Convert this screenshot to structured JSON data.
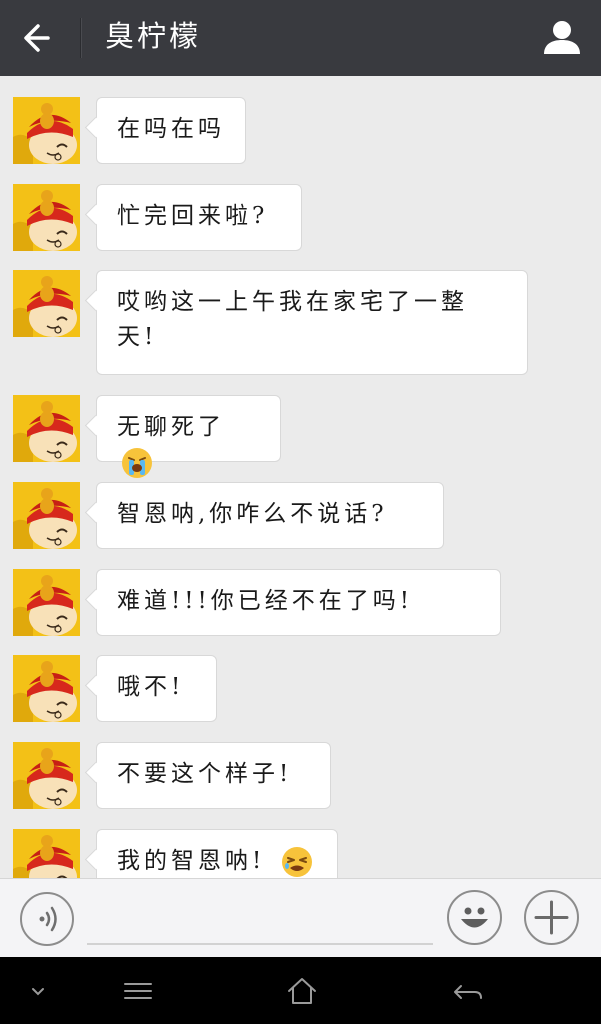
{
  "header": {
    "title": "臭柠檬",
    "back_icon": "arrow-left-icon",
    "profile_icon": "person-icon"
  },
  "messages": [
    {
      "text": "在吗在吗",
      "emoji": ""
    },
    {
      "text": "忙完回来啦?",
      "emoji": ""
    },
    {
      "text": "哎哟这一上午我在家宅了一整天!",
      "emoji": ""
    },
    {
      "text": "无聊死了",
      "emoji": "crying-face"
    },
    {
      "text": "智恩呐,你咋么不说话?",
      "emoji": ""
    },
    {
      "text": "难道!!!你已经不在了吗!",
      "emoji": ""
    },
    {
      "text": "哦不!",
      "emoji": ""
    },
    {
      "text": "不要这个样子!",
      "emoji": ""
    },
    {
      "text": "我的智恩呐!",
      "emoji": "weary-face"
    }
  ],
  "input_bar": {
    "voice_icon": "voice-wave-icon",
    "emoji_icon": "smiley-icon",
    "plus_icon": "plus-icon",
    "text_value": ""
  },
  "nav_bar": {
    "icons": [
      "chevron-down-icon",
      "menu-icon",
      "home-icon",
      "back-icon"
    ]
  },
  "colors": {
    "header_bg": "#393a3f",
    "chat_bg": "#ebebeb",
    "bubble_bg": "#ffffff",
    "avatar_bg": "#f5c418"
  }
}
